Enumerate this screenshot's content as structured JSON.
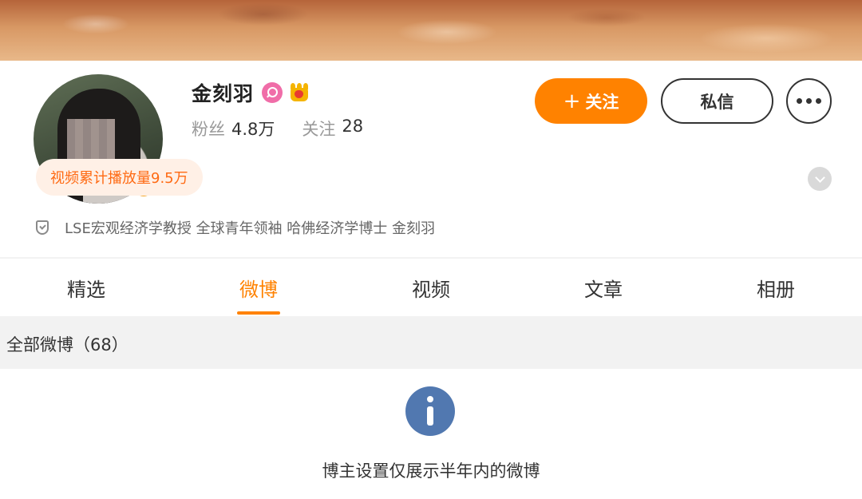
{
  "profile": {
    "name": "金刻羽",
    "followers_label": "粉丝",
    "followers_value": "4.8万",
    "following_label": "关注",
    "following_value": "28",
    "verified_mark": "V"
  },
  "actions": {
    "follow_label": "关注",
    "follow_icon": "+",
    "message_label": "私信"
  },
  "video_stats": "视频累计播放量9.5万",
  "bio": "LSE宏观经济学教授 全球青年领袖 哈佛经济学博士 金刻羽",
  "tabs": [
    {
      "label": "精选",
      "active": false
    },
    {
      "label": "微博",
      "active": true
    },
    {
      "label": "视频",
      "active": false
    },
    {
      "label": "文章",
      "active": false
    },
    {
      "label": "相册",
      "active": false
    }
  ],
  "feed": {
    "title": "全部微博（68）",
    "notice": "博主设置仅展示半年内的微博"
  },
  "colors": {
    "accent": "#ff8200",
    "verified": "#f5a623",
    "info_icon": "#5178b0"
  }
}
